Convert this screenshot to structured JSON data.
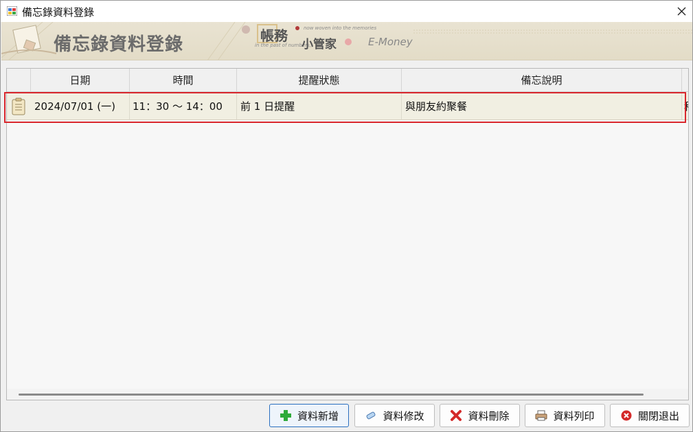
{
  "window": {
    "title": "備忘錄資料登錄"
  },
  "banner": {
    "title": "備忘錄資料登錄",
    "logo_text": "帳務",
    "sub_text": "小管家",
    "tagline_top": "now woven into the memories",
    "tagline_bottom": "in the past of numbers,",
    "brand": "E-Money"
  },
  "grid": {
    "columns": [
      "日期",
      "時間",
      "提醒狀態",
      "備忘說明"
    ],
    "rows": [
      {
        "date": "2024/07/01 (一)",
        "time": "11：30 ～ 14：00",
        "reminder": "前 1 日提醒",
        "note": "與朋友約聚餐",
        "overflow": "秮"
      }
    ]
  },
  "buttons": {
    "add": "資料新增",
    "edit": "資料修改",
    "delete": "資料刪除",
    "print": "資料列印",
    "close": "關閉退出"
  },
  "colors": {
    "selection_outline": "#d9262c",
    "row_background": "#f1efe2",
    "banner_background": "#e6dfcb"
  }
}
